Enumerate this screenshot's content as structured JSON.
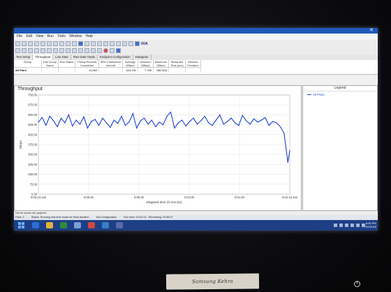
{
  "window": {
    "close_glyph": "✕"
  },
  "menu": [
    "File",
    "Edit",
    "View",
    "Run",
    "Tools",
    "Window",
    "Help"
  ],
  "toolbar": {
    "brand": "IXIA"
  },
  "tabs": [
    "Test Setup",
    "Throughput",
    "Line Data",
    "Raw Data Totals",
    "Endpoint Configuration",
    "Datagram"
  ],
  "table": {
    "headers": [
      "Group",
      "Pair Group Name",
      "Run Status",
      "Timing Records Completed",
      "95% Confidence Interval",
      "Average (Mbps)",
      "Minimum (Mbps)",
      "Maximum (Mbps)",
      "Measured Time (sec)",
      "Relative Precision"
    ],
    "row": {
      "label": "All Pairs",
      "values": [
        "",
        "",
        "11,060",
        "",
        "524.151",
        "7.756",
        "582.500",
        "",
        ""
      ]
    }
  },
  "chart_title": "Throughput",
  "legend": {
    "title": "Legend",
    "items": [
      "All Pairs"
    ]
  },
  "status": {
    "line1": "Not all results are graphed",
    "pairs": "Pairs: 1",
    "state": "Status: Running real-time mode for fixed duration",
    "config": "Ixia Configuration",
    "run": "Run time: 00:02:13 - Remaining: 01:58:47"
  },
  "clock": {
    "time": "8:25 PM",
    "date": "9/1/2015"
  },
  "sticker_text": "Samsung Kehra",
  "chart_data": {
    "type": "line",
    "title": "Throughput",
    "xlabel": "Elapsed time (h:mm:ss)",
    "ylabel": "Mbps",
    "ylim": [
      0,
      750
    ],
    "yticks": [
      "0.00",
      "75.00",
      "150.00",
      "225.00",
      "300.00",
      "375.00",
      "450.00",
      "525.00",
      "600.00",
      "675.00",
      "750.00"
    ],
    "xticks": [
      "0:00:13.142",
      "0:00:20",
      "0:00:40",
      "0:01:00",
      "0:01:20",
      "0:02:13.142"
    ],
    "grid": true,
    "legend": "right panel",
    "series": [
      {
        "name": "All Pairs",
        "color": "#1a3fd6",
        "x": [
          0,
          2,
          4,
          6,
          8,
          10,
          12,
          14,
          16,
          18,
          20,
          22,
          24,
          26,
          28,
          30,
          32,
          34,
          36,
          38,
          40,
          42,
          44,
          46,
          48,
          50,
          52,
          54,
          56,
          58,
          60,
          62,
          64,
          66,
          68,
          70,
          72,
          74,
          76,
          78,
          80,
          82,
          84,
          86,
          88,
          90,
          92,
          94,
          96,
          98,
          100,
          102,
          104,
          106,
          108,
          110,
          112,
          114,
          116,
          118,
          120,
          122,
          124,
          126,
          128,
          130,
          132,
          133
        ],
        "values": [
          545,
          580,
          520,
          590,
          555,
          510,
          575,
          540,
          600,
          515,
          560,
          530,
          585,
          500,
          550,
          565,
          520,
          575,
          540,
          505,
          560,
          535,
          590,
          520,
          545,
          610,
          500,
          555,
          575,
          530,
          560,
          510,
          545,
          525,
          590,
          620,
          500,
          540,
          560,
          515,
          550,
          575,
          530,
          555,
          590,
          540,
          520,
          560,
          600,
          530,
          550,
          575,
          540,
          520,
          595,
          555,
          530,
          570,
          545,
          560,
          580,
          520,
          550,
          540,
          510,
          460,
          240,
          330
        ]
      }
    ]
  }
}
